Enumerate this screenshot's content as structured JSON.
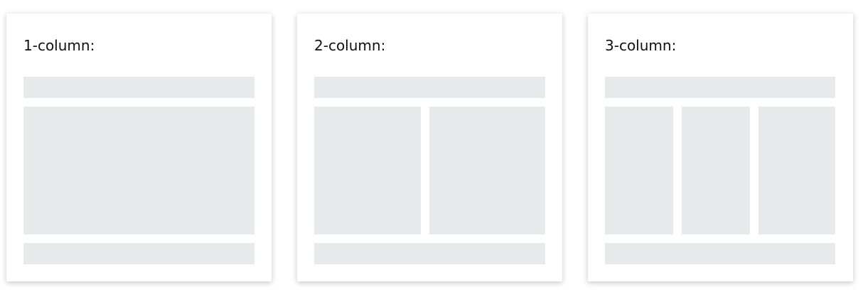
{
  "cards": [
    {
      "title": "1-column:",
      "columns": 1
    },
    {
      "title": "2-column:",
      "columns": 2
    },
    {
      "title": "3-column:",
      "columns": 3
    }
  ],
  "colors": {
    "placeholder": "#e8e9eb",
    "card": "#ffffff"
  }
}
